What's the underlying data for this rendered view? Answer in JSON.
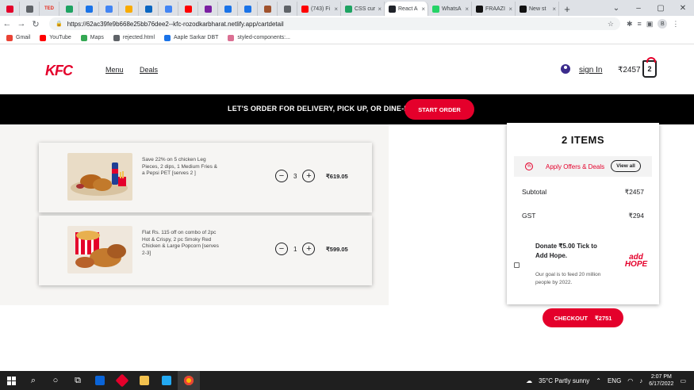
{
  "browser": {
    "tabs": [
      {
        "label": "",
        "color": "#e4002b"
      },
      {
        "label": "",
        "color": "#5f6368"
      },
      {
        "label": "TED",
        "color": "#e62b1e"
      },
      {
        "label": "",
        "color": "#1ea362"
      },
      {
        "label": "",
        "color": "#1a73e8"
      },
      {
        "label": "",
        "color": "#4285f4"
      },
      {
        "label": "",
        "color": "#f9ab00"
      },
      {
        "label": "",
        "color": "#0a66c2"
      },
      {
        "label": "",
        "color": "#4285f4"
      },
      {
        "label": "",
        "color": "#ff0000"
      },
      {
        "label": "",
        "color": "#7b1fa2"
      },
      {
        "label": "",
        "color": "#1a73e8"
      },
      {
        "label": "",
        "color": "#1a73e8"
      },
      {
        "label": "",
        "color": "#a0522d"
      },
      {
        "label": "",
        "color": "#5f6368"
      }
    ],
    "wide_tabs": [
      {
        "label": "(743) Fi",
        "color": "#ff0000",
        "active": false
      },
      {
        "label": "CSS cur",
        "color": "#1ea362",
        "active": false
      },
      {
        "label": "React A",
        "color": "#20232a",
        "active": true
      },
      {
        "label": "WhatsA",
        "color": "#25d366",
        "active": false
      },
      {
        "label": "FRAAZI",
        "color": "#111111",
        "active": false
      },
      {
        "label": "New st",
        "color": "#111111",
        "active": false
      }
    ],
    "url": "https://62ac39fe9b668e25bb76dee2--kfc-rozodkarbharat.netlify.app/cartdetail",
    "profile_initial": "B",
    "bookmarks": [
      {
        "label": "Gmail",
        "color": "#ea4335"
      },
      {
        "label": "YouTube",
        "color": "#ff0000"
      },
      {
        "label": "Maps",
        "color": "#34a853"
      },
      {
        "label": "rejected.html",
        "color": "#5f6368"
      },
      {
        "label": "Aaple Sarkar DBT",
        "color": "#1a73e8"
      },
      {
        "label": "styled-components:...",
        "color": "#db7093"
      }
    ]
  },
  "header": {
    "logo": "KFC",
    "nav": [
      "Menu",
      "Deals"
    ],
    "sign_in": "sign In",
    "cart_amount": "₹2457",
    "cart_count": "2"
  },
  "banner": {
    "text": "LET'S ORDER FOR DELIVERY, PICK UP, OR DINE-IN",
    "button": "START ORDER"
  },
  "cart": {
    "items": [
      {
        "description": "Save 22% on 5 chicken Leg Pieces, 2 dips, 1 Medium Fries & a Pepsi PET [serves 2 ]",
        "quantity": "3",
        "price": "₹619.05",
        "minus": "−",
        "plus": "+"
      },
      {
        "description": "Flat Rs. 115 off on combo of 2pc Hot & Crispy, 2 pc Smoky Red Chicken & Large Popcorn [serves 2-3]",
        "quantity": "1",
        "price": "₹599.05",
        "minus": "−",
        "plus": "+"
      }
    ]
  },
  "summary": {
    "title": "2 ITEMS",
    "offers_label": "Apply Offers & Deals",
    "view_all": "View all",
    "offer_icon": "%",
    "subtotal_label": "Subtotal",
    "subtotal_value": "₹2457",
    "gst_label": "GST",
    "gst_value": "₹294",
    "donate_title": "Donate ₹5.00 Tick to Add Hope.",
    "donate_sub": "Our goal is to feed 20 million people by 2022.",
    "add_hope_line1": "add",
    "add_hope_line2": "HOPE"
  },
  "checkout": {
    "label": "CHECKOUT",
    "amount": "₹2751"
  },
  "taskbar": {
    "weather": "35°C  Partly sunny",
    "lang": "ENG",
    "time": "2:07 PM",
    "date": "6/17/2022"
  },
  "colors": {
    "brand_red": "#e4002b",
    "banner_black": "#000000"
  }
}
